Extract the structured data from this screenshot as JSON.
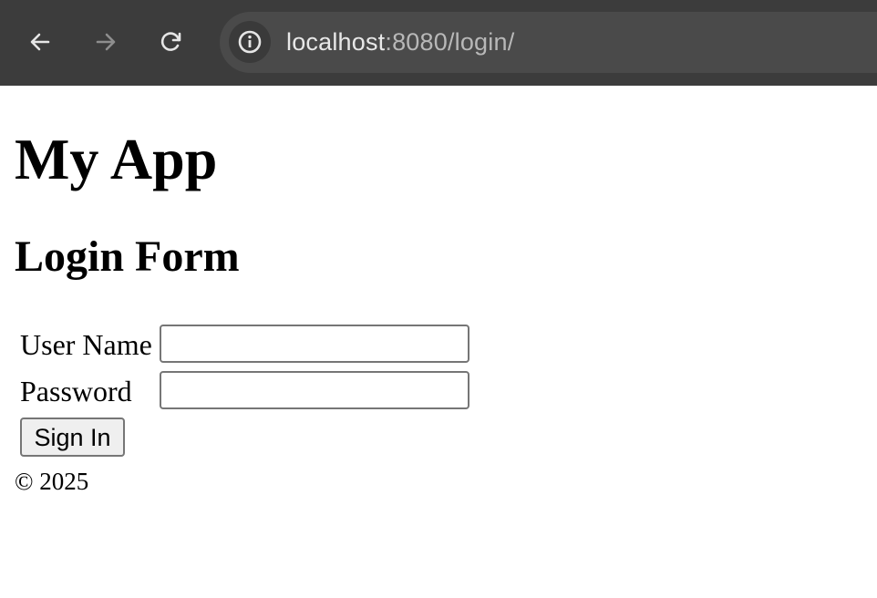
{
  "browser": {
    "url_host": "localhost",
    "url_rest": ":8080/login/",
    "icons": [
      "back-arrow-icon",
      "forward-arrow-icon",
      "reload-icon",
      "info-icon"
    ],
    "forward_enabled": false
  },
  "page": {
    "app_title": "My App",
    "form_title": "Login Form",
    "username_label": "User Name",
    "username_value": "",
    "password_label": "Password",
    "password_value": "",
    "sign_in_label": "Sign In",
    "footer": "© 2025"
  }
}
